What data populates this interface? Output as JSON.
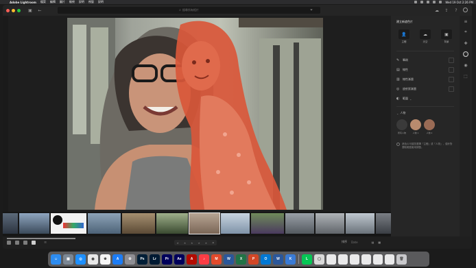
{
  "menubar": {
    "app_name": "Adobe Lightroom",
    "items": [
      "檔案",
      "編輯",
      "圖片",
      "檢視",
      "說明",
      "視窗",
      "說明"
    ],
    "datetime": "Wed 19 Oct 2:26 PM"
  },
  "window": {
    "search_placeholder": "搜尋所有相片"
  },
  "panel": {
    "title": "建立新遮色片",
    "presets": [
      {
        "label": "主體",
        "icon": "person-icon"
      },
      {
        "label": "天空",
        "icon": "sky-icon"
      },
      {
        "label": "背景",
        "icon": "background-icon"
      }
    ],
    "tools": [
      {
        "label": "筆刷",
        "icon": "brush-icon"
      },
      {
        "label": "線性",
        "icon": "linear-gradient-icon"
      },
      {
        "label": "線性漸層",
        "icon": "radial-icon"
      },
      {
        "label": "放射狀漸層",
        "icon": "radial-gradient-icon"
      },
      {
        "label": "範圍",
        "icon": "range-icon"
      }
    ],
    "people_title": "人物",
    "faces": [
      {
        "label": "所有人物"
      },
      {
        "label": "人物 1"
      },
      {
        "label": "人物 2"
      }
    ],
    "hint": "遮色片可讓您選擇「主體」或「人物」，僅針對選取範圍套用調整。"
  },
  "bottombar": {
    "sort_label": "排序",
    "sort_value": "Date"
  },
  "dock": {
    "apps": [
      {
        "name": "Finder",
        "color": "#2d8cf0",
        "glyph": "☺"
      },
      {
        "name": "Launchpad",
        "color": "#7b8794",
        "glyph": "▦"
      },
      {
        "name": "Safari",
        "color": "#1e90ff",
        "glyph": "◎"
      },
      {
        "name": "Chrome",
        "color": "#e8e8e8",
        "glyph": "◉"
      },
      {
        "name": "Photos",
        "color": "#f5f5f5",
        "glyph": "❀"
      },
      {
        "name": "App Store",
        "color": "#1c7cf4",
        "glyph": "A"
      },
      {
        "name": "System Preferences",
        "color": "#8e8e93",
        "glyph": "⚙"
      },
      {
        "name": "Photoshop",
        "color": "#001e36",
        "glyph": "Ps"
      },
      {
        "name": "Lightroom",
        "color": "#001a33",
        "glyph": "Lr"
      },
      {
        "name": "Premiere Pro",
        "color": "#00005b",
        "glyph": "Pr"
      },
      {
        "name": "After Effects",
        "color": "#00005b",
        "glyph": "Ae"
      },
      {
        "name": "Acrobat",
        "color": "#b30b00",
        "glyph": "A"
      },
      {
        "name": "Music",
        "color": "#fc3c44",
        "glyph": "♪"
      },
      {
        "name": "Media",
        "color": "#e24a2b",
        "glyph": "M"
      },
      {
        "name": "Word",
        "color": "#2b579a",
        "glyph": "W"
      },
      {
        "name": "Excel",
        "color": "#217346",
        "glyph": "X"
      },
      {
        "name": "PowerPoint",
        "color": "#d24726",
        "glyph": "P"
      },
      {
        "name": "Outlook",
        "color": "#0078d4",
        "glyph": "O"
      },
      {
        "name": "Word 2",
        "color": "#2b579a",
        "glyph": "W"
      },
      {
        "name": "Keynote",
        "color": "#3a7bd5",
        "glyph": "K"
      },
      {
        "name": "Line",
        "color": "#06c755",
        "glyph": "L"
      },
      {
        "name": "Preview",
        "color": "#d9d9d9",
        "glyph": "▢"
      }
    ]
  }
}
